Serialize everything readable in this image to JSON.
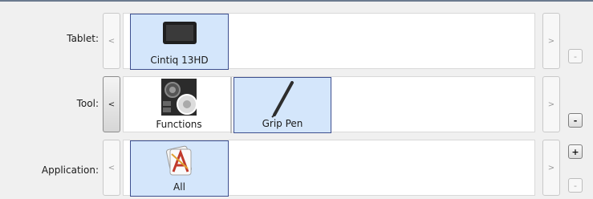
{
  "tablet_row": {
    "label": "Tablet:",
    "prev": "<",
    "next": ">",
    "remove": "-",
    "items": [
      {
        "label": "Cintiq 13HD",
        "icon": "tablet-icon",
        "selected": true
      }
    ]
  },
  "tool_row": {
    "label": "Tool:",
    "prev": "<",
    "next": ">",
    "remove": "-",
    "items": [
      {
        "label": "Functions",
        "icon": "functions-icon",
        "selected": false
      },
      {
        "label": "Grip Pen",
        "icon": "pen-icon",
        "selected": true
      }
    ]
  },
  "application_row": {
    "label": "Application:",
    "prev": "<",
    "next": ">",
    "add": "+",
    "remove": "-",
    "items": [
      {
        "label": "All",
        "icon": "all-applications-icon",
        "selected": true
      }
    ]
  },
  "colors": {
    "selection_bg": "#d4e6fb",
    "selection_border": "#3d4f8f"
  }
}
